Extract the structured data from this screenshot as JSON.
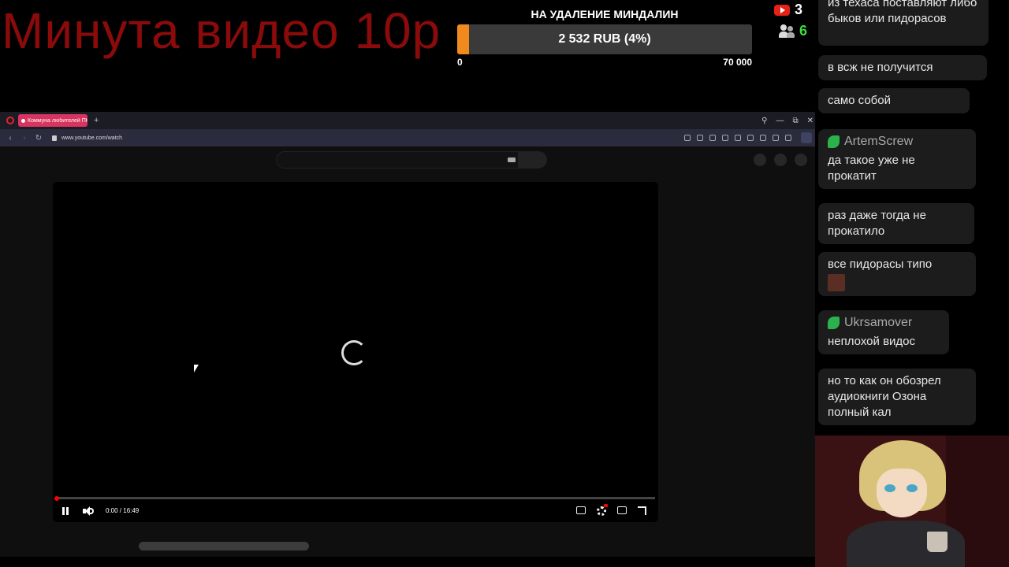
{
  "overlay": {
    "promo_text": "Минута видео 10р",
    "goal": {
      "title": "НА УДАЛЕНИЕ МИНДАЛИН",
      "amount_text": "2 532 RUB (4%)",
      "progress_fraction": 0.04,
      "min_label": "0",
      "max_label": "70 000",
      "fill_color": "#f0891e"
    },
    "stats": {
      "youtube_count": "3",
      "viewers_count": "6",
      "youtube_icon": "youtube-icon",
      "viewers_icon": "viewers-icon"
    }
  },
  "browser": {
    "tab_title": "Коммуна любителей ПК",
    "new_tab_label": "+",
    "url": "www.youtube.com/watch",
    "window_controls": [
      "search-icon",
      "minimize-icon",
      "restore-icon",
      "close-icon"
    ]
  },
  "player": {
    "time_display": "0:00 / 16:49",
    "state": "loading"
  },
  "chat": {
    "messages": [
      {
        "author": "",
        "text": "из техаса поставляют либо быков или пидорасов"
      },
      {
        "author": "",
        "text": "в всж не получится"
      },
      {
        "author": "",
        "text": "само собой"
      },
      {
        "author": "ArtemScrew",
        "text": "да такое уже не прокатит"
      },
      {
        "author": "",
        "text": "раз даже тогда не прокатило"
      },
      {
        "author": "",
        "text": "все пидорасы типо"
      },
      {
        "author": "Ukrsamover",
        "text": "неплохой видос"
      },
      {
        "author": "",
        "text": "но то как он обозрел аудиокниги Озона полный кал"
      }
    ]
  }
}
